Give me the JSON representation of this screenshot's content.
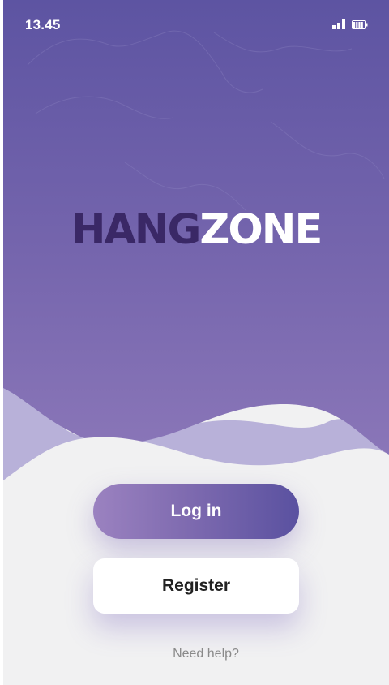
{
  "status_bar": {
    "time": "13.45",
    "signal_icon": "signal-bars-icon",
    "battery_icon": "battery-icon"
  },
  "logo": {
    "part1": "HANG",
    "part2": "ZONE"
  },
  "actions": {
    "login_label": "Log in",
    "register_label": "Register",
    "help_label": "Need help?"
  },
  "colors": {
    "hero_top": "#5d54a2",
    "hero_bottom": "#8a76b8",
    "wave_light": "#b8b1d9",
    "logo_dark": "#3a2866",
    "background": "#f1f1f2"
  }
}
